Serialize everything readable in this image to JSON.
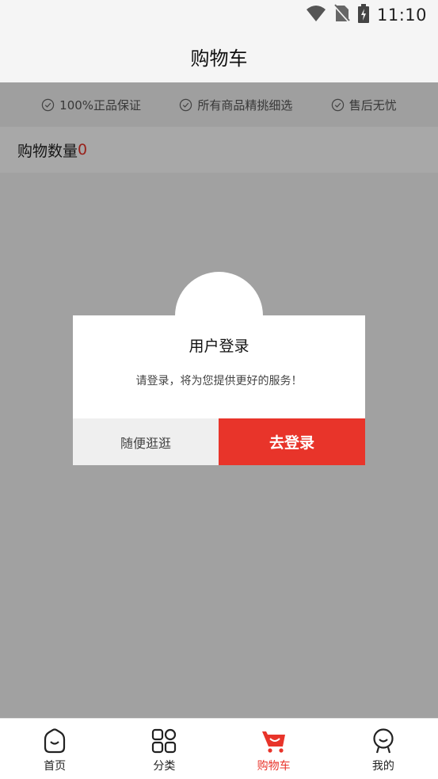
{
  "status_bar": {
    "time": "11:10"
  },
  "header": {
    "title": "购物车"
  },
  "guarantees": [
    {
      "label": "100%正品保证"
    },
    {
      "label": "所有商品精挑细选"
    },
    {
      "label": "售后无忧"
    }
  ],
  "cart": {
    "count_label": "购物数量",
    "count": "0"
  },
  "dialog": {
    "title": "用户登录",
    "message": "请登录，将为您提供更好的服务！",
    "browse_label": "随便逛逛",
    "login_label": "去登录"
  },
  "nav": {
    "items": [
      {
        "label": "首页",
        "icon": "home-face-icon"
      },
      {
        "label": "分类",
        "icon": "category-grid-icon"
      },
      {
        "label": "购物车",
        "icon": "cart-icon"
      },
      {
        "label": "我的",
        "icon": "profile-icon"
      }
    ],
    "active_index": 2
  },
  "colors": {
    "accent": "#e8342a",
    "overlay": "rgba(0,0,0,0.34)"
  }
}
